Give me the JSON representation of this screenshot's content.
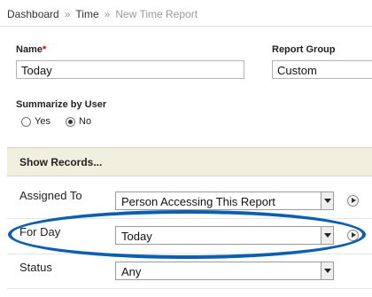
{
  "breadcrumb": {
    "items": [
      "Dashboard",
      "Time",
      "New Time Report"
    ],
    "separator": "»"
  },
  "form": {
    "name": {
      "label": "Name",
      "required_mark": "*",
      "value": "Today"
    },
    "report_group": {
      "label": "Report Group",
      "value": "Custom"
    },
    "summarize": {
      "label": "Summarize by User",
      "options": [
        "Yes",
        "No"
      ],
      "selected": "No"
    }
  },
  "section": {
    "title": "Show Records..."
  },
  "filters": [
    {
      "label": "Assigned To",
      "value": "Person Accessing This Report"
    },
    {
      "label": "For Day",
      "value": "Today"
    },
    {
      "label": "Status",
      "value": "Any"
    }
  ],
  "colors": {
    "highlight_oval": "#0a5fb0",
    "section_bg": "#f1efdd",
    "required": "#cc0000"
  }
}
